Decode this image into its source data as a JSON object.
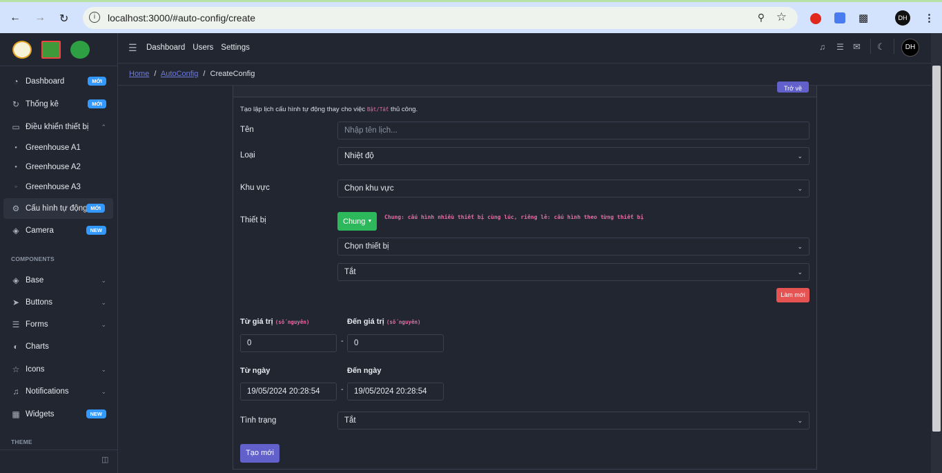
{
  "browser": {
    "url": "localhost:3000/#auto-config/create"
  },
  "header": {
    "links": [
      "Dashboard",
      "Users",
      "Settings"
    ]
  },
  "breadcrumb": {
    "home": "Home",
    "sep": "/",
    "autoconfig": "AutoConfig",
    "current": "CreateConfig"
  },
  "sidebar": {
    "items": [
      {
        "label": "Dashboard",
        "badge": "MỚI"
      },
      {
        "label": "Thống kê",
        "badge": "MỚI"
      },
      {
        "label": "Điều khiển thiết bị"
      },
      {
        "label": "Greenhouse A1"
      },
      {
        "label": "Greenhouse A2"
      },
      {
        "label": "Greenhouse A3"
      },
      {
        "label": "Cấu hình tự động",
        "badge": "MỚI"
      },
      {
        "label": "Camera",
        "badge": "NEW"
      }
    ],
    "components_title": "COMPONENTS",
    "components": [
      "Base",
      "Buttons",
      "Forms",
      "Charts",
      "Icons",
      "Notifications",
      "Widgets"
    ],
    "widgets_badge": "NEW",
    "theme_title": "THEME"
  },
  "form": {
    "back_label": "Trở về",
    "intro_before": "Tạo lập lịch cấu hình tự động thay cho việc ",
    "intro_code": "Bật/Tắt",
    "intro_after": " thủ công.",
    "name_label": "Tên",
    "name_placeholder": "Nhập tên lịch...",
    "type_label": "Loại",
    "type_value": "Nhiệt độ",
    "area_label": "Khu vực",
    "area_value": "Chọn khu vực",
    "device_label": "Thiết bị",
    "device_mode": "Chung",
    "device_note": "Chung: cấu hình nhiều thiết bị cùng lúc, riêng lẻ: cấu hình theo từng thiết bị",
    "device_value": "Chọn thiết bị",
    "device_state": "Tắt",
    "reset_label": "Làm mới",
    "from_value_label": "Từ giá trị",
    "to_value_label": "Đến giá trị",
    "int_hint": "(số nguyên)",
    "from_value": "0",
    "to_value": "0",
    "dash": "-",
    "from_date_label": "Từ ngày",
    "to_date_label": "Đến ngày",
    "from_date": "19/05/2024 20:28:54",
    "to_date": "19/05/2024 20:28:54",
    "status_label": "Tình trạng",
    "status_value": "Tắt",
    "submit_label": "Tạo mới"
  },
  "colors": {
    "primary": "#6261cc",
    "success": "#2eb85c",
    "danger": "#e55353",
    "info": "#3399ff",
    "bg": "#212631"
  }
}
